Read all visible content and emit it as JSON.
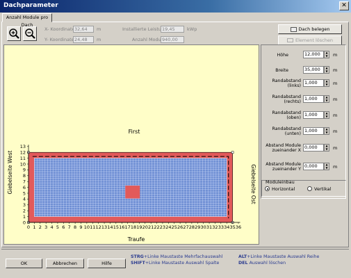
{
  "window": {
    "title": "Dachparameter",
    "close": "✕"
  },
  "tab": {
    "label": "Anzahl Module pro Dach"
  },
  "coords": {
    "x_label": "X- Koordinate",
    "x_value": "32,64",
    "x_unit": "m",
    "y_label": "Y- Koordinate",
    "y_value": "24,48",
    "y_unit": "m",
    "power_label": "Installierte Leistung",
    "power_value": "19,45",
    "power_unit": "kWp",
    "modules_label": "Anzahl Module",
    "modules_value": "940,00"
  },
  "side_buttons": {
    "roof": "Dach belegen",
    "delete": "Element löschen"
  },
  "diagram": {
    "top_label": "First",
    "bottom_label": "Traufe",
    "left_label": "Giebelseite West",
    "right_label": "Giebelseite Ost",
    "x_ticks": [
      "0",
      "1",
      "2",
      "3",
      "4",
      "5",
      "6",
      "7",
      "8",
      "9",
      "10",
      "11",
      "12",
      "13",
      "14",
      "15",
      "16",
      "17",
      "18",
      "19",
      "20",
      "21",
      "22",
      "23",
      "24",
      "25",
      "26",
      "27",
      "28",
      "29",
      "30",
      "31",
      "32",
      "33",
      "34",
      "35",
      "36"
    ],
    "y_ticks": [
      "0",
      "1",
      "2",
      "3",
      "4",
      "5",
      "6",
      "7",
      "8",
      "9",
      "10",
      "11",
      "12",
      "13"
    ],
    "colors": {
      "roof": "#e25a5a",
      "module": "#6f8fd4",
      "canvas": "#fffec8"
    }
  },
  "props": {
    "hoehe": {
      "label": "Höhe",
      "value": "12,000",
      "unit": "m"
    },
    "breite": {
      "label": "Breite",
      "value": "35,000",
      "unit": "m"
    },
    "rand_links": {
      "label1": "Randabstand",
      "label2": "(links)",
      "value": "1,000",
      "unit": "m"
    },
    "rand_rechts": {
      "label1": "Randabstand",
      "label2": "(rechts)",
      "value": "1,000",
      "unit": "m"
    },
    "rand_oben": {
      "label1": "Randabstand",
      "label2": "(oben)",
      "value": "1,000",
      "unit": "m"
    },
    "rand_unten": {
      "label1": "Randabstand",
      "label2": "(unten)",
      "value": "1,000",
      "unit": "m"
    },
    "abst_x": {
      "label1": "Abstand Module",
      "label2": "zueinander X",
      "value": "0,000",
      "unit": "m"
    },
    "abst_y": {
      "label1": "Abstand Module",
      "label2": "zueinander Y",
      "value": "0,000",
      "unit": "m"
    }
  },
  "orientation": {
    "title": "Moduleinbau",
    "horizontal": "Horizontal",
    "vertical": "Vertikal"
  },
  "buttons": {
    "ok": "OK",
    "cancel": "Abbrechen",
    "help": "Hilfe"
  },
  "hints": {
    "strg_key": "STRG",
    "strg_text": "+Linke Maustaste  Mehrfachauswahl",
    "shift_key": "SHIFT",
    "shift_text": "+Linke Maustaste Auswahl Spalte",
    "alt_key": "ALT",
    "alt_text": "+Linke Maustaste Auswahl Reihe",
    "del_key": "DEL",
    "del_text": "Auswahl löschen"
  }
}
